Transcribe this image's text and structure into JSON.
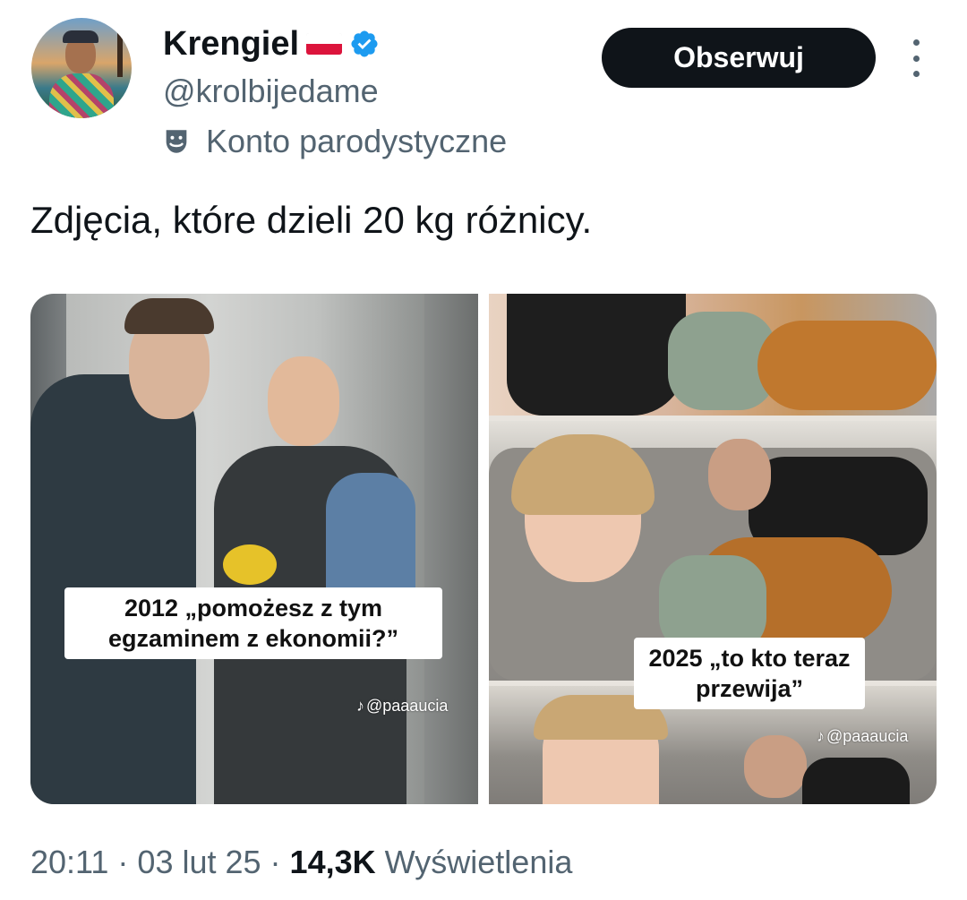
{
  "author": {
    "display_name": "Krengiel",
    "handle": "@krolbijedame",
    "parody_label": "Konto parodystyczne",
    "flag_icon": "poland-flag-icon",
    "verified_icon": "verified-badge-icon",
    "verified_color": "#1d9bf0"
  },
  "actions": {
    "follow_label": "Obserwuj",
    "more_icon": "more-vertical-icon"
  },
  "tweet": {
    "text": "Zdjęcia, które dzieli 20 kg różnicy."
  },
  "media": {
    "left": {
      "caption_line1": "2012 „pomożesz z tym",
      "caption_line2": "egzaminem z ekonomii?”",
      "watermark": "@paaaucia"
    },
    "right": {
      "caption_line1": "2025 „to kto teraz",
      "caption_line2": "przewija”",
      "watermark": "@paaaucia"
    }
  },
  "meta": {
    "time": "20:11",
    "sep1": "·",
    "date": "03 lut 25",
    "sep2": "·",
    "views_count": "14,3K",
    "views_label": "Wyświetlenia"
  },
  "colors": {
    "text_primary": "#0f1419",
    "text_secondary": "#536471",
    "button_bg": "#0f1419"
  }
}
